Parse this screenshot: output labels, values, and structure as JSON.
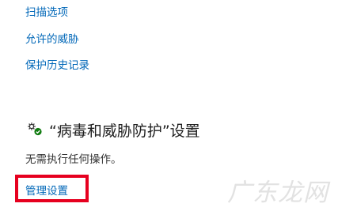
{
  "links": {
    "scan_options": "扫描选项",
    "allowed_threats": "允许的威胁",
    "protection_history": "保护历史记录"
  },
  "settings_section": {
    "icon": "gear-check-icon",
    "title": "“病毒和威胁防护”设置",
    "status": "无需执行任何操作。",
    "manage_link": "管理设置"
  },
  "watermark": {
    "text": "广东龙网"
  },
  "colors": {
    "link": "#0067b8",
    "highlight_box": "#e6001f",
    "status_ok": "#107c10"
  }
}
